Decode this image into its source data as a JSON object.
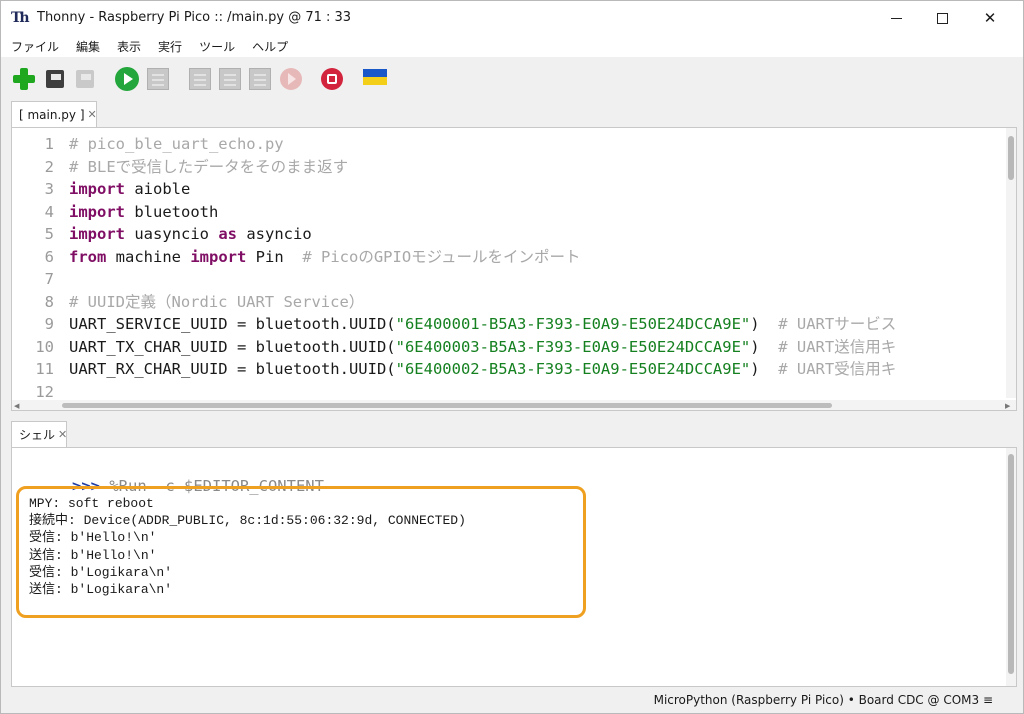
{
  "window": {
    "title": "Thonny  -  Raspberry Pi Pico :: /main.py  @  71 : 33",
    "app_icon_text": "Th",
    "minimize": "—",
    "close": "✕"
  },
  "menu": [
    "ファイル",
    "編集",
    "表示",
    "実行",
    "ツール",
    "ヘルプ"
  ],
  "toolbar": {
    "icons": [
      "new-file-icon",
      "load-icon",
      "save-icon",
      "run-icon",
      "debug-icon",
      "step-over-icon",
      "step-into-icon",
      "step-out-icon",
      "resume-icon",
      "stop-icon",
      "ukraine-flag-icon"
    ],
    "colors": {
      "run": "#23a63b",
      "stop": "#d3243d",
      "new": "#1fa81f",
      "flag_blue": "#1a57c8",
      "flag_yellow": "#f3cf1a"
    }
  },
  "editor": {
    "tab_label": "[ main.py ]",
    "tab_close": "✕",
    "line_numbers": [
      "1",
      "2",
      "3",
      "4",
      "5",
      "6",
      "7",
      "8",
      "9",
      "10",
      "11",
      "12"
    ],
    "lines": [
      [
        {
          "t": "# pico_ble_uart_echo.py",
          "c": "cm"
        }
      ],
      [
        {
          "t": "# BLEで受信したデータをそのまま返す",
          "c": "cm"
        }
      ],
      [
        {
          "t": "import",
          "c": "kw"
        },
        {
          "t": " aioble",
          "c": ""
        }
      ],
      [
        {
          "t": "import",
          "c": "kw"
        },
        {
          "t": " bluetooth",
          "c": ""
        }
      ],
      [
        {
          "t": "import",
          "c": "kw"
        },
        {
          "t": " uasyncio ",
          "c": ""
        },
        {
          "t": "as",
          "c": "kw"
        },
        {
          "t": " asyncio",
          "c": ""
        }
      ],
      [
        {
          "t": "from",
          "c": "kw"
        },
        {
          "t": " machine ",
          "c": ""
        },
        {
          "t": "import",
          "c": "kw"
        },
        {
          "t": " Pin  ",
          "c": ""
        },
        {
          "t": "# PicoのGPIOモジュールをインポート",
          "c": "cm"
        }
      ],
      [],
      [
        {
          "t": "# UUID定義（Nordic UART Service）",
          "c": "cm"
        }
      ],
      [
        {
          "t": "UART_SERVICE_UUID = bluetooth.UUID(",
          "c": ""
        },
        {
          "t": "\"6E400001-B5A3-F393-E0A9-E50E24DCCA9E\"",
          "c": "st"
        },
        {
          "t": ")  ",
          "c": ""
        },
        {
          "t": "# UARTサービス",
          "c": "cm"
        }
      ],
      [
        {
          "t": "UART_TX_CHAR_UUID = bluetooth.UUID(",
          "c": ""
        },
        {
          "t": "\"6E400003-B5A3-F393-E0A9-E50E24DCCA9E\"",
          "c": "st"
        },
        {
          "t": ")  ",
          "c": ""
        },
        {
          "t": "# UART送信用キ",
          "c": "cm"
        }
      ],
      [
        {
          "t": "UART_RX_CHAR_UUID = bluetooth.UUID(",
          "c": ""
        },
        {
          "t": "\"6E400002-B5A3-F393-E0A9-E50E24DCCA9E\"",
          "c": "st"
        },
        {
          "t": ")  ",
          "c": ""
        },
        {
          "t": "# UART受信用キ",
          "c": "cm"
        }
      ],
      []
    ]
  },
  "shell": {
    "tab_label": "シェル",
    "tab_close": "✕",
    "prompt": ">>>",
    "command": " %Run -c $EDITOR_CONTENT",
    "highlight_color": "#f0a020",
    "output": [
      "MPY: soft reboot",
      "接続中: Device(ADDR_PUBLIC, 8c:1d:55:06:32:9d, CONNECTED)",
      "受信: b'Hello!\\n'",
      "送信: b'Hello!\\n'",
      "受信: b'Logikara\\n'",
      "送信: b'Logikara\\n'"
    ]
  },
  "status": {
    "text": "MicroPython (Raspberry Pi Pico)  •  Board CDC @ COM3  ≡"
  }
}
